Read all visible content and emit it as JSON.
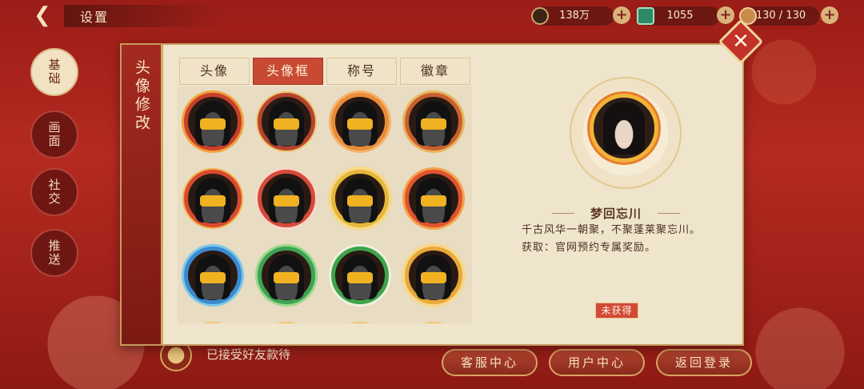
{
  "header": {
    "title": "设置",
    "resources": [
      {
        "icon": "coin-icon",
        "value": "138万"
      },
      {
        "icon": "jade-icon",
        "value": "1055"
      },
      {
        "icon": "stamina-bowl-icon",
        "value": "130 / 130"
      }
    ]
  },
  "sidebar": {
    "items": [
      {
        "label": "基础",
        "active": true
      },
      {
        "label": "画面"
      },
      {
        "label": "社交"
      },
      {
        "label": "推送"
      }
    ]
  },
  "dialog": {
    "title": "头像修改",
    "tabs": [
      {
        "label": "头像"
      },
      {
        "label": "头像框",
        "active": true
      },
      {
        "label": "称号"
      },
      {
        "label": "徽章"
      }
    ],
    "selected_frame": {
      "name": "梦回忘川",
      "description": "千古风华一朝聚，不聚蓬莱聚忘川。",
      "source": "获取：官网预约专属奖励。",
      "status": "未获得"
    }
  },
  "footer": {
    "friend_status": "已接受好友款待",
    "buttons": [
      {
        "label": "客服中心"
      },
      {
        "label": "用户中心"
      },
      {
        "label": "返回登录"
      }
    ]
  },
  "colors": {
    "background_red": "#9b1d17",
    "panel_cream": "#efe4cc",
    "accent_red": "#c84a33",
    "gold": "#f0b221"
  }
}
